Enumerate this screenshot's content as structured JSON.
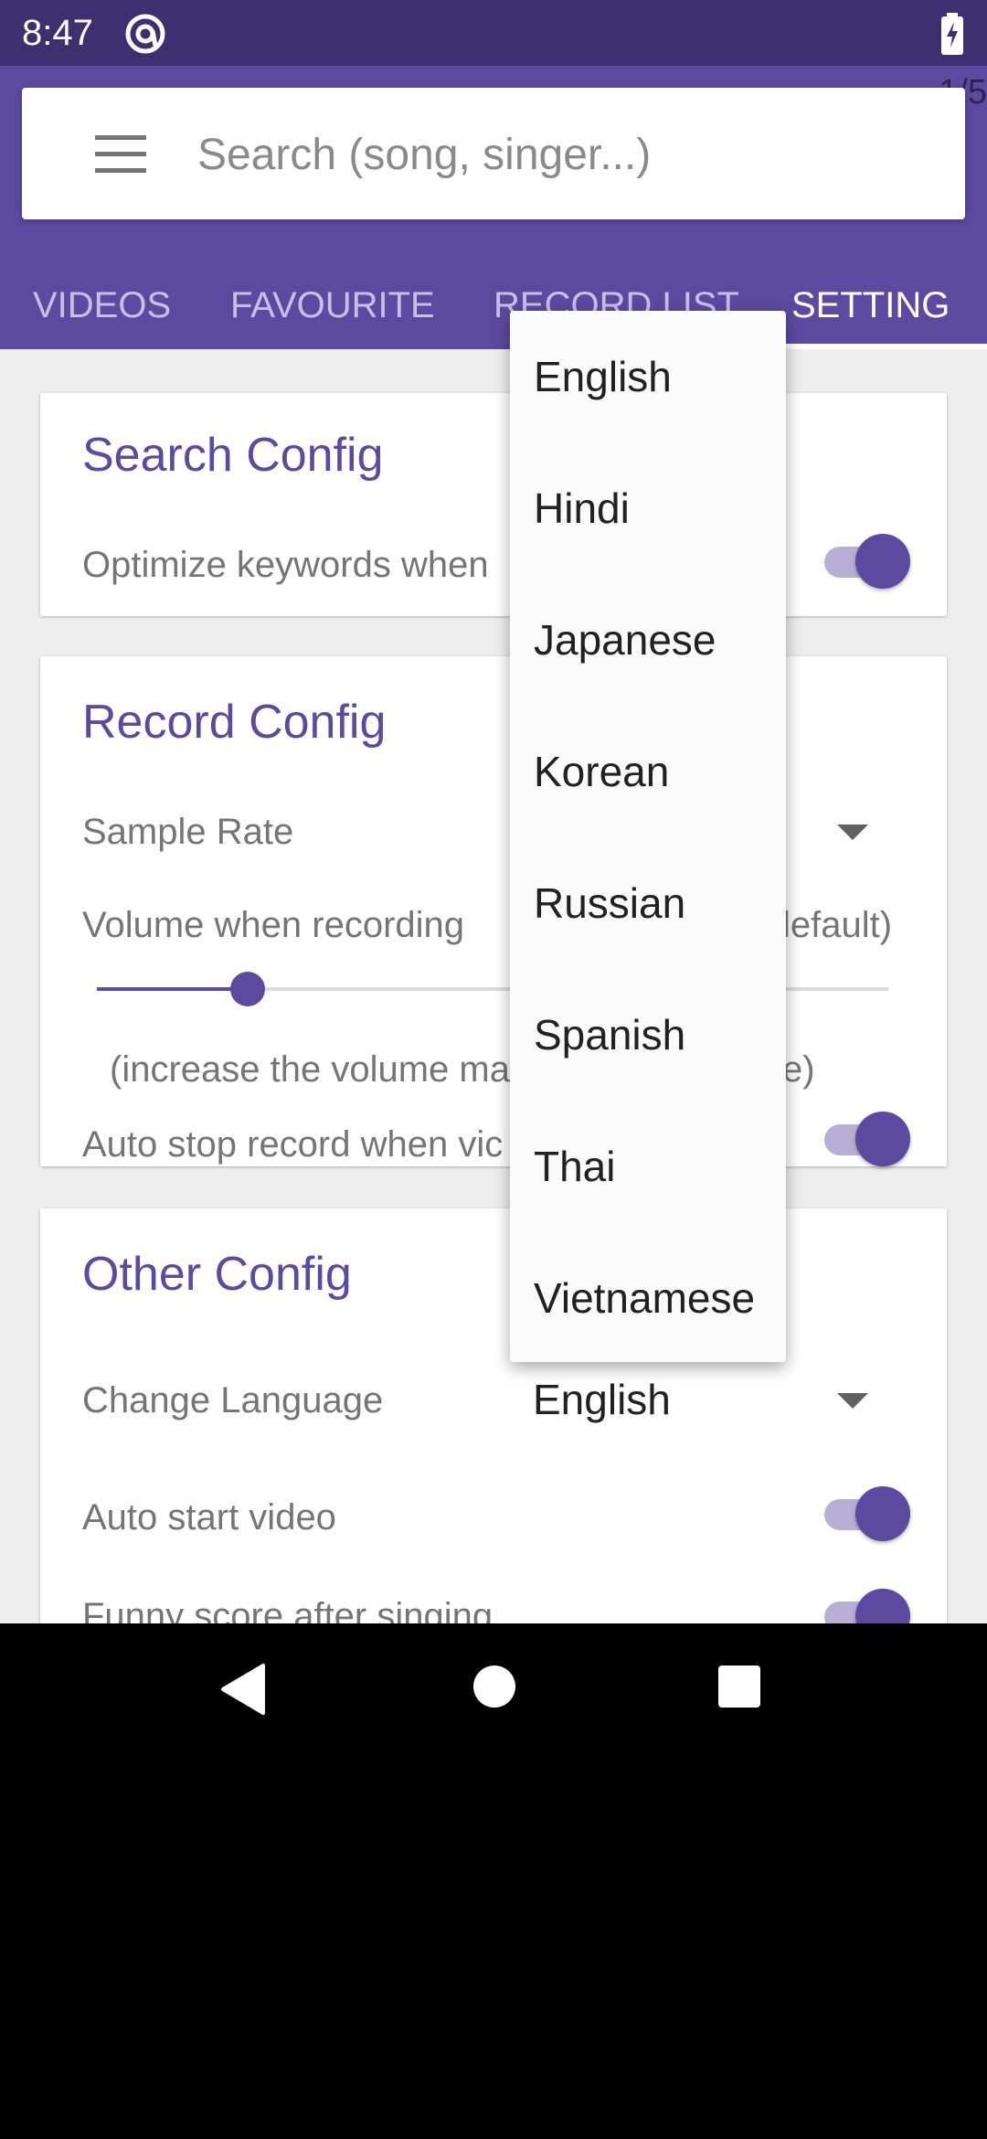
{
  "status_bar": {
    "time": "8:47"
  },
  "app_bar": {
    "page_indicator": "1/5",
    "search_placeholder": "Search (song, singer...)",
    "tabs": [
      {
        "label": "VIDEOS"
      },
      {
        "label": "FAVOURITE"
      },
      {
        "label": "RECORD LIST"
      },
      {
        "label": "SETTING"
      }
    ],
    "active_tab": "SETTING"
  },
  "search_config": {
    "title": "Search Config",
    "optimize_label": "Optimize keywords when",
    "optimize_enabled": true
  },
  "record_config": {
    "title": "Record Config",
    "sample_rate_label": "Sample Rate",
    "volume_label": "Volume when recording",
    "volume_value_fragment": "lefault)",
    "volume_level_fraction": 0.19,
    "hint_left": "(increase the volume ma",
    "hint_right": "e)",
    "auto_stop_label": "Auto stop record when vic",
    "auto_stop_enabled": true
  },
  "other_config": {
    "title": "Other Config",
    "change_language_label": "Change Language",
    "language_value": "English",
    "auto_start_label": "Auto start video",
    "auto_start_enabled": true,
    "funny_score_label": "Funny score after singing",
    "funny_score_enabled": true
  },
  "language_popup": {
    "options": [
      "English",
      "Hindi",
      "Japanese",
      "Korean",
      "Russian",
      "Spanish",
      "Thai",
      "Vietnamese"
    ]
  },
  "colors": {
    "status_bar": "#3e2f71",
    "primary": "#5b4aa0",
    "toggle_track": "#b7afd6",
    "background": "#eeeeee"
  },
  "icons": {
    "status": [
      "at-sign-icon",
      "battery-charging-icon"
    ],
    "nav": [
      "back-icon",
      "home-icon",
      "recents-icon"
    ]
  }
}
